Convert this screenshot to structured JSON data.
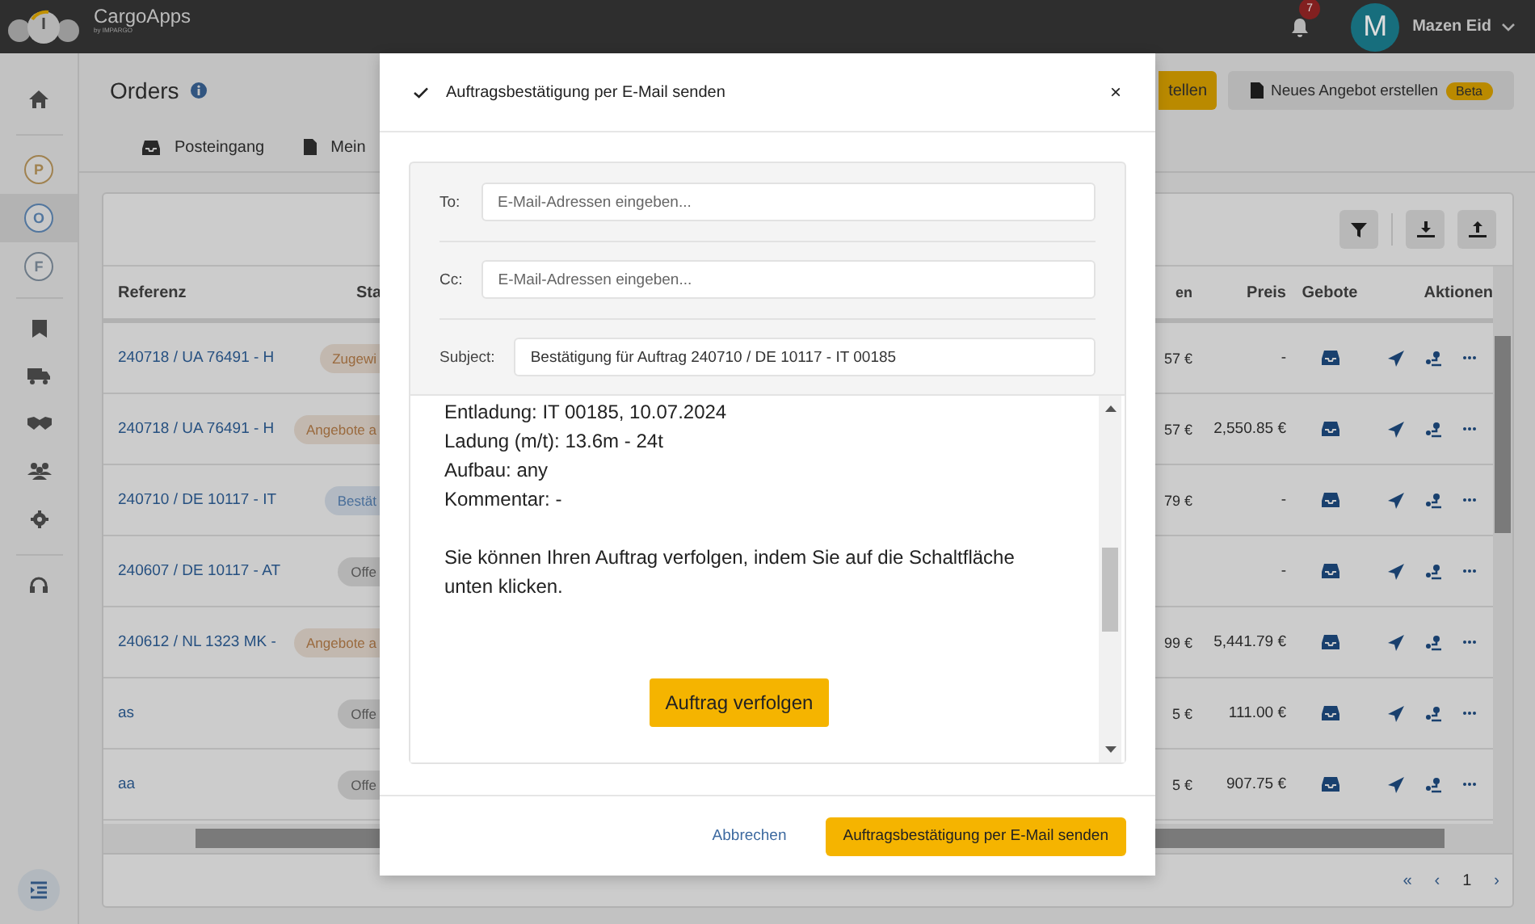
{
  "topbar": {
    "brand": "CargoApps",
    "brand_sub": "by IMPARGO",
    "notifications": "7",
    "avatar_letter": "M",
    "user": "Mazen Eid"
  },
  "sidebar": {
    "workspaces": [
      {
        "letter": "P",
        "selected": false,
        "color": "#a08250"
      },
      {
        "letter": "O",
        "selected": true,
        "color": "#52769e"
      },
      {
        "letter": "F",
        "selected": false,
        "color": "#6e7b88"
      }
    ]
  },
  "page": {
    "title": "Orders",
    "tabs": [
      {
        "label": "Posteingang"
      },
      {
        "label": "Mein"
      }
    ],
    "buttons": [
      {
        "kind": "primary",
        "label": "tellen"
      },
      {
        "kind": "secondary",
        "label": "Neues Angebot erstellen",
        "badge": "Beta"
      }
    ]
  },
  "table": {
    "columns_left": [
      "Referenz",
      "Sta"
    ],
    "columns_right": [
      "en",
      "Preis",
      "Gebote",
      "Aktionen"
    ],
    "rows": [
      {
        "reference": "240718 / UA 76491 - H",
        "status": "Zugewi",
        "color": "#9a6a3e",
        "col_3": "57 €",
        "price": "-"
      },
      {
        "reference": "240718 / UA 76491 - H",
        "status": "Angebote a",
        "color": "#9a6a3e",
        "col_3": "57 €",
        "price": "2,550.85 €"
      },
      {
        "reference": "240710 / DE 10117 - IT",
        "status": "Bestät",
        "color": "#4a6f9a",
        "col_3": "79 €",
        "price": "-"
      },
      {
        "reference": "240607 / DE 10117 - AT",
        "status": "Offe",
        "color": "#555555",
        "col_3": "",
        "price": "-"
      },
      {
        "reference": "240612 / NL 1323 MK -",
        "status": "Angebote a",
        "color": "#9a6a3e",
        "col_3": "99 €",
        "price": "5,441.79 €"
      },
      {
        "reference": "as",
        "status": "Offe",
        "color": "#555555",
        "col_3": "5 €",
        "price": "111.00 €"
      },
      {
        "reference": "aa",
        "status": "Offe",
        "color": "#555555",
        "col_3": "5 €",
        "price": "907.75 €"
      }
    ]
  },
  "pagination": {
    "first": "«",
    "prev": "‹",
    "page": "1",
    "next": "›"
  },
  "modal": {
    "title": "Auftragsbestätigung per E-Mail senden",
    "close": "×",
    "fields": [
      {
        "label": "To:",
        "placeholder": "E-Mail-Adressen eingeben..."
      },
      {
        "label": "Cc:",
        "placeholder": "E-Mail-Adressen eingeben..."
      },
      {
        "label": "Subject:",
        "value": "Bestätigung für Auftrag 240710 / DE 10117 - IT 00185"
      }
    ],
    "body_lines": [
      "Entladung: IT 00185, 10.07.2024",
      "Ladung (m/t): 13.6m - 24t",
      "Aufbau: any",
      "Kommentar: -"
    ],
    "body_paragraph": "Sie können Ihren Auftrag verfolgen, indem Sie auf die Schaltfläche unten klicken.",
    "track_button": "Auftrag verfolgen",
    "cancel": "Abbrechen",
    "send": "Auftragsbestätigung per E-Mail senden"
  }
}
